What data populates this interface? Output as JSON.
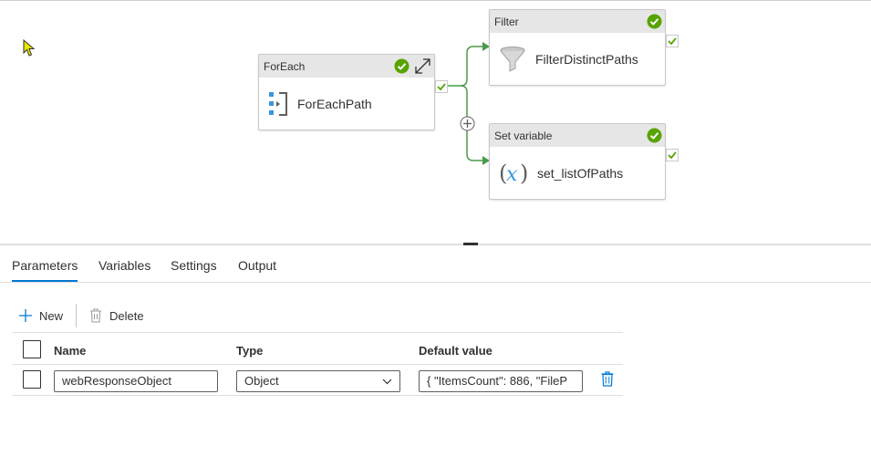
{
  "pipeline": {
    "foreach": {
      "type_label": "ForEach",
      "name": "ForEachPath",
      "status": "success"
    },
    "filter": {
      "type_label": "Filter",
      "name": "FilterDistinctPaths",
      "status": "success"
    },
    "setvariable": {
      "type_label": "Set variable",
      "name": "set_listOfPaths",
      "status": "success"
    }
  },
  "tabs": [
    {
      "label": "Parameters",
      "active": true
    },
    {
      "label": "Variables",
      "active": false
    },
    {
      "label": "Settings",
      "active": false
    },
    {
      "label": "Output",
      "active": false
    }
  ],
  "toolbar": {
    "new_label": "New",
    "delete_label": "Delete"
  },
  "grid": {
    "headers": {
      "name": "Name",
      "type": "Type",
      "default": "Default value"
    },
    "rows": [
      {
        "name": "webResponseObject",
        "type": "Object",
        "default": "{      \"ItemsCount\": 886,  \"FileP"
      }
    ]
  },
  "colors": {
    "accent": "#0078d4",
    "success": "#57a300",
    "connector": "#4a9a4a",
    "node_header": "#e6e6e6",
    "icon_blue": "#3a96dd",
    "cursor": "#e8e800"
  },
  "icons": {
    "foreach": "foreach-icon",
    "filter": "funnel-icon",
    "setvariable": "variable-x-icon",
    "status": "check-circle-icon",
    "expand": "expand-icon",
    "add": "plus-circle-icon",
    "new": "plus-icon",
    "delete": "trash-icon"
  }
}
